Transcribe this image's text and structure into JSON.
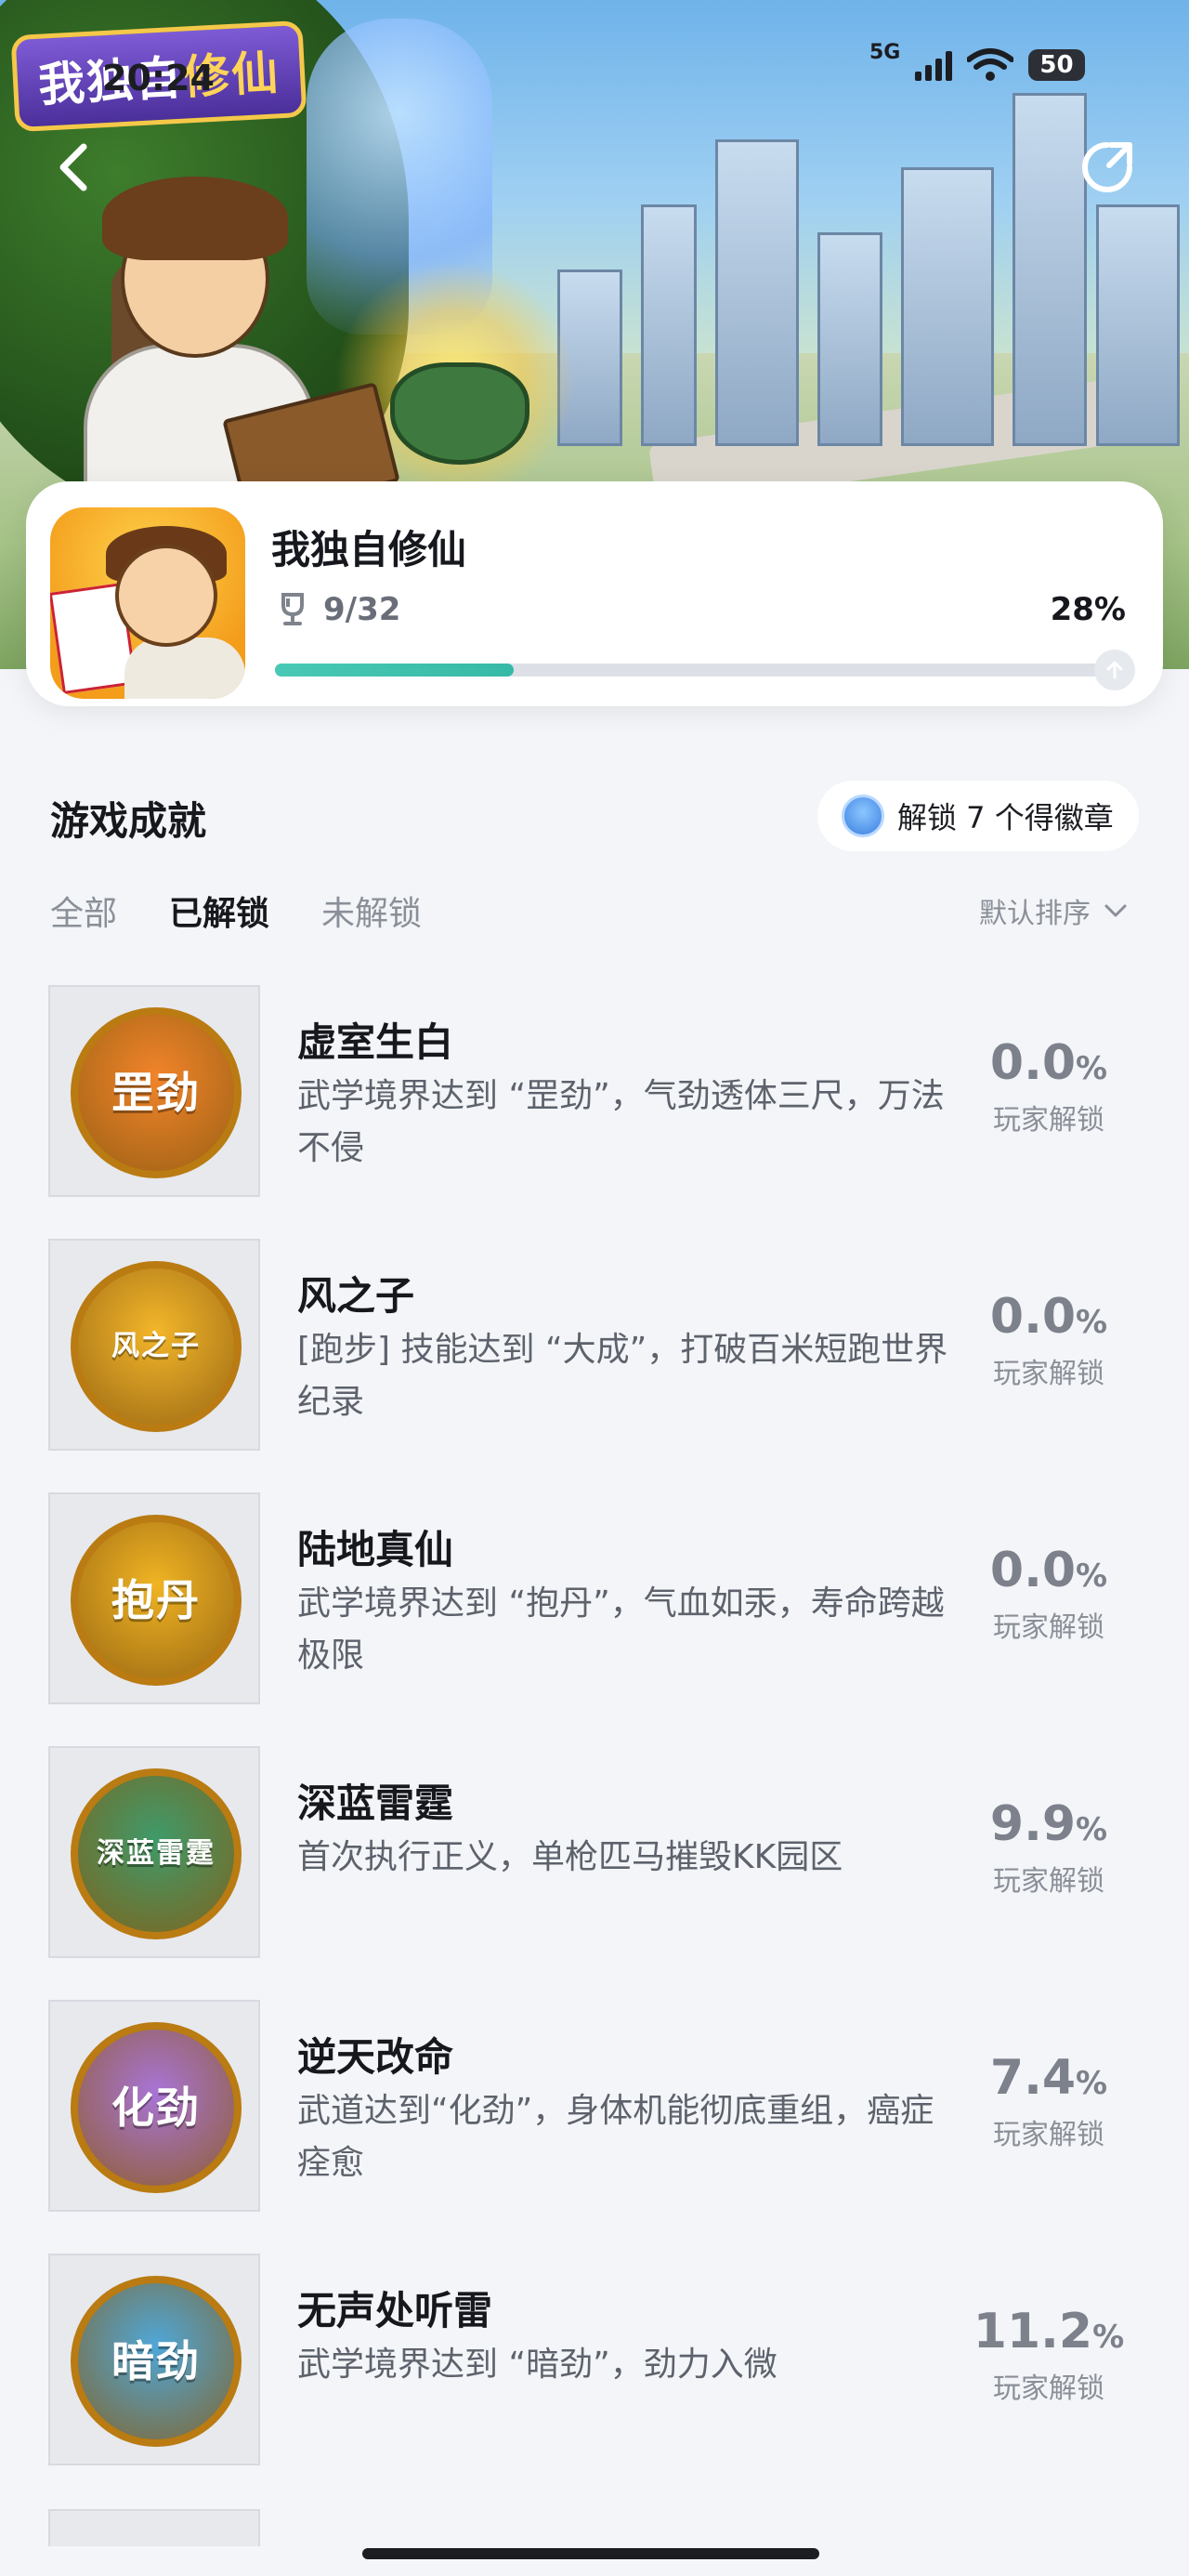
{
  "status_bar": {
    "time": "20:24",
    "network": "5G",
    "battery": "50"
  },
  "hero": {
    "logo_text_a": "我独自",
    "logo_text_b": "修仙"
  },
  "game": {
    "title": "我独自修仙",
    "unlocked": "9/32",
    "percent_text": "28%",
    "progress": 0.28
  },
  "section": {
    "title": "游戏成就",
    "badge_pill": "解锁 7 个得徽章"
  },
  "tabs": {
    "all": "全部",
    "unlocked": "已解锁",
    "locked": "未解锁",
    "active": "已解锁"
  },
  "sort": {
    "label": "默认排序"
  },
  "achievements": [
    {
      "title": "虚室生白",
      "desc": "武学境界达到 “罡劲”，气劲透体三尺，万法不侵",
      "rate": "0.0",
      "rate_unit": "%",
      "rate_label": "玩家解锁",
      "badge": "罡劲",
      "color": "#f2842a"
    },
    {
      "title": "风之子",
      "desc": "[跑步] 技能达到 “大成”，打破百米短跑世界纪录",
      "rate": "0.0",
      "rate_unit": "%",
      "rate_label": "玩家解锁",
      "badge": "风之子",
      "color": "#f3b62a"
    },
    {
      "title": "陆地真仙",
      "desc": "武学境界达到 “抱丹”，气血如汞，寿命跨越极限",
      "rate": "0.0",
      "rate_unit": "%",
      "rate_label": "玩家解锁",
      "badge": "抱丹",
      "color": "#f0b423"
    },
    {
      "title": "深蓝雷霆",
      "desc": "首次执行正义，单枪匹马摧毁KK园区",
      "rate": "9.9",
      "rate_unit": "%",
      "rate_label": "玩家解锁",
      "badge": "深蓝雷霆",
      "color": "#3f9a6a"
    },
    {
      "title": "逆天改命",
      "desc": "武道达到“化劲”，身体机能彻底重组，癌症痊愈",
      "rate": "7.4",
      "rate_unit": "%",
      "rate_label": "玩家解锁",
      "badge": "化劲",
      "color": "#a874d6"
    },
    {
      "title": "无声处听雷",
      "desc": "武学境界达到 “暗劲”，劲力入微",
      "rate": "11.2",
      "rate_unit": "%",
      "rate_label": "玩家解锁",
      "badge": "暗劲",
      "color": "#4fa7d8"
    }
  ]
}
